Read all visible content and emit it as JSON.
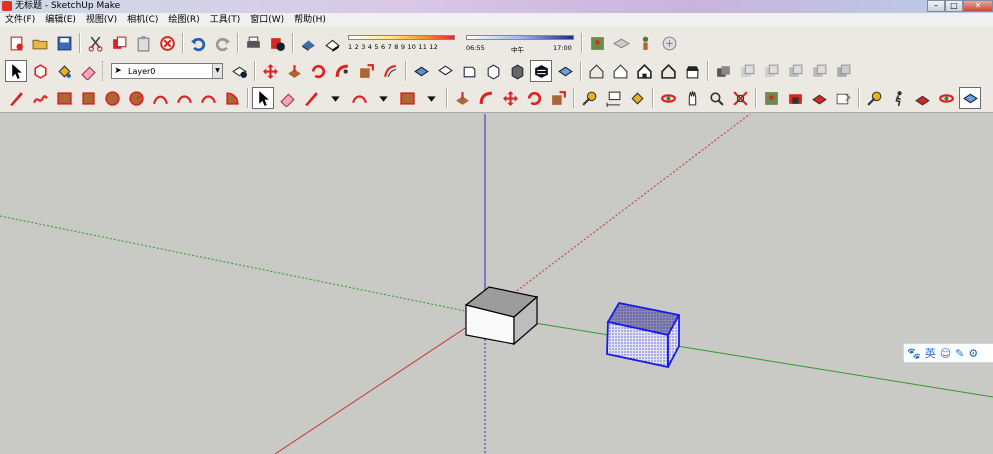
{
  "window": {
    "title": "无标题 - SketchUp Make",
    "minimize": "–",
    "maximize": "□",
    "close": "✕"
  },
  "menu": [
    "文件(F)",
    "编辑(E)",
    "视图(V)",
    "相机(C)",
    "绘图(R)",
    "工具(T)",
    "窗口(W)",
    "帮助(H)"
  ],
  "layer": {
    "current": "Layer0"
  },
  "shadows": {
    "months": "1 2 3 4 5 6 7 8 9 10 11 12",
    "time_start": "06:55",
    "time_noon": "中午",
    "time_end": "17:00"
  },
  "ime": {
    "lang": "英"
  },
  "scene": {
    "axis_colors": {
      "red": "#c8322d",
      "green": "#2f9a2f",
      "blue": "#2c2cc8"
    },
    "selection_color": "#1a1ae6"
  }
}
